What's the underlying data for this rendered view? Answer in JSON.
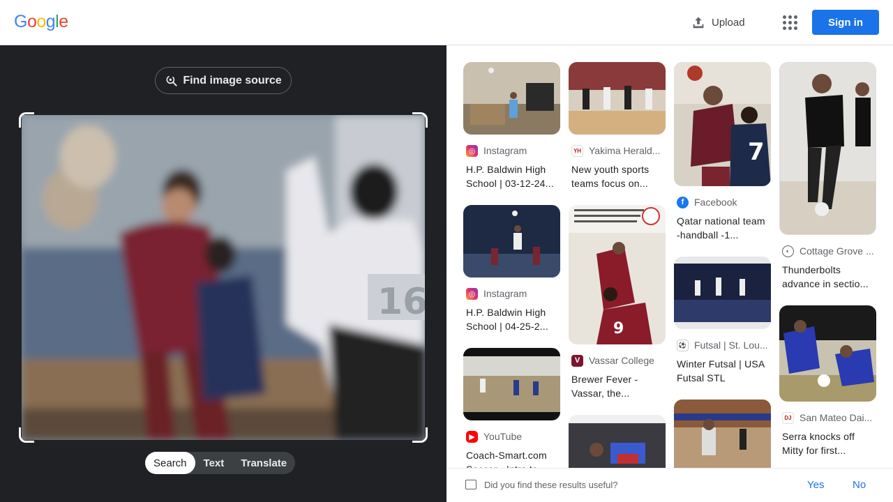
{
  "header": {
    "logo_letters": [
      "G",
      "o",
      "o",
      "g",
      "l",
      "e"
    ],
    "logo_colors": [
      "#4285F4",
      "#EA4335",
      "#FBBC05",
      "#4285F4",
      "#34A853",
      "#EA4335"
    ],
    "upload_label": "Upload",
    "signin_label": "Sign in"
  },
  "lens": {
    "find_source_label": "Find image source",
    "modes": [
      "Search",
      "Text",
      "Translate"
    ],
    "active_mode": "Search"
  },
  "results": [
    {
      "source": "Instagram",
      "source_icon": "instagram-icon",
      "title": "H.P. Baldwin High School | 03-12-24..."
    },
    {
      "source": "Instagram",
      "source_icon": "instagram-icon",
      "title": "H.P. Baldwin High School | 04-25-2..."
    },
    {
      "source": "YouTube",
      "source_icon": "youtube-icon",
      "title": "Coach-Smart.com Soccer - Intro to..."
    },
    {
      "source": "Yakima Herald...",
      "source_icon": "yakima-herald-icon",
      "title": "New youth sports teams focus on..."
    },
    {
      "source": "Vassar College",
      "source_icon": "vassar-icon",
      "title": "Brewer Fever - Vassar, the..."
    },
    {
      "source": "Facebook",
      "source_icon": "facebook-icon",
      "title": "Qatar national team -handball -1..."
    },
    {
      "source": "Futsal | St. Lou...",
      "source_icon": "futsal-icon",
      "title": "Winter Futsal | USA Futsal STL"
    },
    {
      "source": "Cottage Grove ...",
      "source_icon": "globe-icon",
      "title": "Thunderbolts advance in sectio..."
    },
    {
      "source": "San Mateo Dai...",
      "source_icon": "san-mateo-icon",
      "title": "Serra knocks off Mitty for first..."
    }
  ],
  "feedback": {
    "question": "Did you find these results useful?",
    "yes_label": "Yes",
    "no_label": "No"
  },
  "colors": {
    "accent": "#1a73e8",
    "dark_panel": "#202124"
  }
}
